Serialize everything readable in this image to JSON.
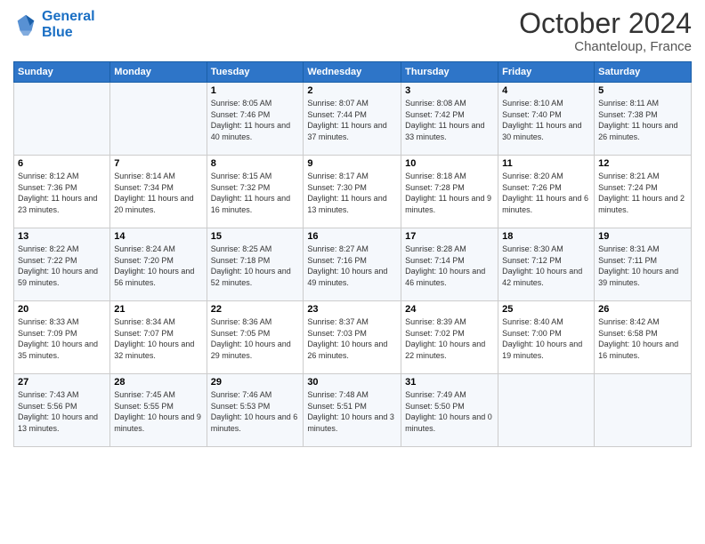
{
  "header": {
    "logo": {
      "line1": "General",
      "line2": "Blue"
    },
    "title": "October 2024",
    "subtitle": "Chanteloup, France"
  },
  "weekdays": [
    "Sunday",
    "Monday",
    "Tuesday",
    "Wednesday",
    "Thursday",
    "Friday",
    "Saturday"
  ],
  "weeks": [
    [
      {
        "day": "",
        "sunrise": "",
        "sunset": "",
        "daylight": ""
      },
      {
        "day": "",
        "sunrise": "",
        "sunset": "",
        "daylight": ""
      },
      {
        "day": "1",
        "sunrise": "Sunrise: 8:05 AM",
        "sunset": "Sunset: 7:46 PM",
        "daylight": "Daylight: 11 hours and 40 minutes."
      },
      {
        "day": "2",
        "sunrise": "Sunrise: 8:07 AM",
        "sunset": "Sunset: 7:44 PM",
        "daylight": "Daylight: 11 hours and 37 minutes."
      },
      {
        "day": "3",
        "sunrise": "Sunrise: 8:08 AM",
        "sunset": "Sunset: 7:42 PM",
        "daylight": "Daylight: 11 hours and 33 minutes."
      },
      {
        "day": "4",
        "sunrise": "Sunrise: 8:10 AM",
        "sunset": "Sunset: 7:40 PM",
        "daylight": "Daylight: 11 hours and 30 minutes."
      },
      {
        "day": "5",
        "sunrise": "Sunrise: 8:11 AM",
        "sunset": "Sunset: 7:38 PM",
        "daylight": "Daylight: 11 hours and 26 minutes."
      }
    ],
    [
      {
        "day": "6",
        "sunrise": "Sunrise: 8:12 AM",
        "sunset": "Sunset: 7:36 PM",
        "daylight": "Daylight: 11 hours and 23 minutes."
      },
      {
        "day": "7",
        "sunrise": "Sunrise: 8:14 AM",
        "sunset": "Sunset: 7:34 PM",
        "daylight": "Daylight: 11 hours and 20 minutes."
      },
      {
        "day": "8",
        "sunrise": "Sunrise: 8:15 AM",
        "sunset": "Sunset: 7:32 PM",
        "daylight": "Daylight: 11 hours and 16 minutes."
      },
      {
        "day": "9",
        "sunrise": "Sunrise: 8:17 AM",
        "sunset": "Sunset: 7:30 PM",
        "daylight": "Daylight: 11 hours and 13 minutes."
      },
      {
        "day": "10",
        "sunrise": "Sunrise: 8:18 AM",
        "sunset": "Sunset: 7:28 PM",
        "daylight": "Daylight: 11 hours and 9 minutes."
      },
      {
        "day": "11",
        "sunrise": "Sunrise: 8:20 AM",
        "sunset": "Sunset: 7:26 PM",
        "daylight": "Daylight: 11 hours and 6 minutes."
      },
      {
        "day": "12",
        "sunrise": "Sunrise: 8:21 AM",
        "sunset": "Sunset: 7:24 PM",
        "daylight": "Daylight: 11 hours and 2 minutes."
      }
    ],
    [
      {
        "day": "13",
        "sunrise": "Sunrise: 8:22 AM",
        "sunset": "Sunset: 7:22 PM",
        "daylight": "Daylight: 10 hours and 59 minutes."
      },
      {
        "day": "14",
        "sunrise": "Sunrise: 8:24 AM",
        "sunset": "Sunset: 7:20 PM",
        "daylight": "Daylight: 10 hours and 56 minutes."
      },
      {
        "day": "15",
        "sunrise": "Sunrise: 8:25 AM",
        "sunset": "Sunset: 7:18 PM",
        "daylight": "Daylight: 10 hours and 52 minutes."
      },
      {
        "day": "16",
        "sunrise": "Sunrise: 8:27 AM",
        "sunset": "Sunset: 7:16 PM",
        "daylight": "Daylight: 10 hours and 49 minutes."
      },
      {
        "day": "17",
        "sunrise": "Sunrise: 8:28 AM",
        "sunset": "Sunset: 7:14 PM",
        "daylight": "Daylight: 10 hours and 46 minutes."
      },
      {
        "day": "18",
        "sunrise": "Sunrise: 8:30 AM",
        "sunset": "Sunset: 7:12 PM",
        "daylight": "Daylight: 10 hours and 42 minutes."
      },
      {
        "day": "19",
        "sunrise": "Sunrise: 8:31 AM",
        "sunset": "Sunset: 7:11 PM",
        "daylight": "Daylight: 10 hours and 39 minutes."
      }
    ],
    [
      {
        "day": "20",
        "sunrise": "Sunrise: 8:33 AM",
        "sunset": "Sunset: 7:09 PM",
        "daylight": "Daylight: 10 hours and 35 minutes."
      },
      {
        "day": "21",
        "sunrise": "Sunrise: 8:34 AM",
        "sunset": "Sunset: 7:07 PM",
        "daylight": "Daylight: 10 hours and 32 minutes."
      },
      {
        "day": "22",
        "sunrise": "Sunrise: 8:36 AM",
        "sunset": "Sunset: 7:05 PM",
        "daylight": "Daylight: 10 hours and 29 minutes."
      },
      {
        "day": "23",
        "sunrise": "Sunrise: 8:37 AM",
        "sunset": "Sunset: 7:03 PM",
        "daylight": "Daylight: 10 hours and 26 minutes."
      },
      {
        "day": "24",
        "sunrise": "Sunrise: 8:39 AM",
        "sunset": "Sunset: 7:02 PM",
        "daylight": "Daylight: 10 hours and 22 minutes."
      },
      {
        "day": "25",
        "sunrise": "Sunrise: 8:40 AM",
        "sunset": "Sunset: 7:00 PM",
        "daylight": "Daylight: 10 hours and 19 minutes."
      },
      {
        "day": "26",
        "sunrise": "Sunrise: 8:42 AM",
        "sunset": "Sunset: 6:58 PM",
        "daylight": "Daylight: 10 hours and 16 minutes."
      }
    ],
    [
      {
        "day": "27",
        "sunrise": "Sunrise: 7:43 AM",
        "sunset": "Sunset: 5:56 PM",
        "daylight": "Daylight: 10 hours and 13 minutes."
      },
      {
        "day": "28",
        "sunrise": "Sunrise: 7:45 AM",
        "sunset": "Sunset: 5:55 PM",
        "daylight": "Daylight: 10 hours and 9 minutes."
      },
      {
        "day": "29",
        "sunrise": "Sunrise: 7:46 AM",
        "sunset": "Sunset: 5:53 PM",
        "daylight": "Daylight: 10 hours and 6 minutes."
      },
      {
        "day": "30",
        "sunrise": "Sunrise: 7:48 AM",
        "sunset": "Sunset: 5:51 PM",
        "daylight": "Daylight: 10 hours and 3 minutes."
      },
      {
        "day": "31",
        "sunrise": "Sunrise: 7:49 AM",
        "sunset": "Sunset: 5:50 PM",
        "daylight": "Daylight: 10 hours and 0 minutes."
      },
      {
        "day": "",
        "sunrise": "",
        "sunset": "",
        "daylight": ""
      },
      {
        "day": "",
        "sunrise": "",
        "sunset": "",
        "daylight": ""
      }
    ]
  ]
}
